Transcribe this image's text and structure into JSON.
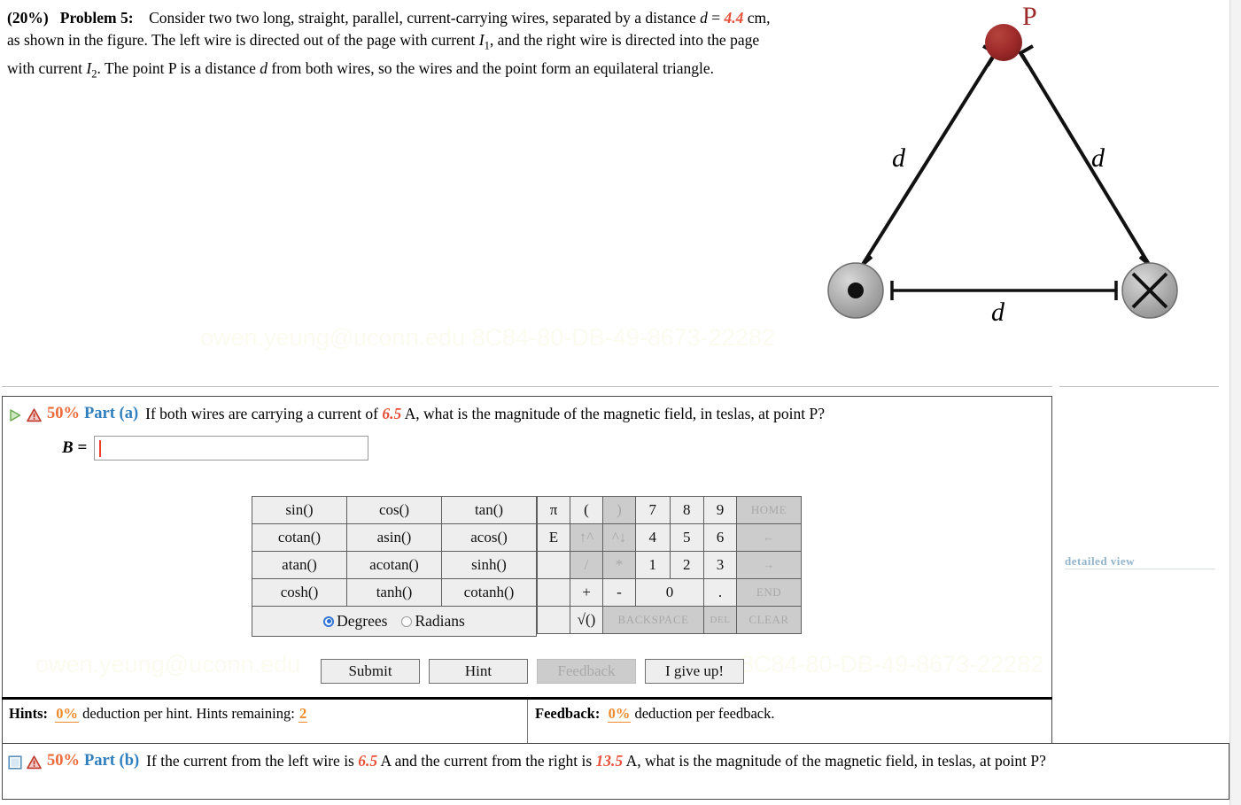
{
  "problem": {
    "weight": "(20%)",
    "label": "Problem 5:",
    "text_1": "Consider two two long, straight, parallel, current-carrying wires, separated by a distance ",
    "var_d": "d",
    "eq": " = ",
    "distance_value": "4.4",
    "text_2": " cm, as shown in the figure. The left wire is directed out of the page with current ",
    "current_1": "I",
    "current_1_sub": "1",
    "text_3": ", and the right wire is directed into the page with current ",
    "current_2": "I",
    "current_2_sub": "2",
    "text_4": ". The point P is a distance ",
    "var_d2": "d",
    "text_5": " from both wires, so the wires and the point form an equilateral triangle."
  },
  "figure": {
    "point_label": "P",
    "side_left_label": "d",
    "side_right_label": "d",
    "base_label": "d",
    "left_wire_symbol": "dot-out-of-page",
    "right_wire_symbol": "cross-into-page",
    "point_color": "#9e2a2a",
    "wire_fill": "#a9a9a9"
  },
  "part_a": {
    "percent": "50%",
    "name": "Part (a)",
    "text": "If both wires are carrying a current of ",
    "current_value": "6.5",
    "text_after": " A, what is the magnitude of the magnetic field, in teslas, at point P?",
    "answer_label": "B =",
    "answer_value": "",
    "expand_icon": "play-triangle-icon",
    "warning_icon": "warning-triangle-icon"
  },
  "part_b": {
    "percent": "50%",
    "name": "Part (b)",
    "text": "If the current from the left wire is ",
    "current_left": "6.5",
    "text_mid": " A and the current from the right is ",
    "current_right": "13.5",
    "text_after": " A, what is the magnitude of the magnetic field, in teslas, at point P?",
    "collapse_icon": "square-collapse-icon",
    "warning_icon": "warning-triangle-icon"
  },
  "calculator": {
    "trig_rows": [
      [
        "sin()",
        "cos()",
        "tan()"
      ],
      [
        "cotan()",
        "asin()",
        "acos()"
      ],
      [
        "atan()",
        "acotan()",
        "sinh()"
      ],
      [
        "cosh()",
        "tanh()",
        "cotanh()"
      ]
    ],
    "mode_degrees": "Degrees",
    "mode_radians": "Radians",
    "mode_selected": "Degrees",
    "keys": {
      "pi": "π",
      "paren_open": "(",
      "paren_close": ")",
      "exp": "E",
      "up_arrow": "↑^",
      "down_arrow": "^↓",
      "divide": "/",
      "multiply": "*",
      "plus": "+",
      "minus": "-",
      "zero": "0",
      "dot": ".",
      "sqrt": "√()",
      "seven": "7",
      "eight": "8",
      "nine": "9",
      "four": "4",
      "five": "5",
      "six": "6",
      "one": "1",
      "two": "2",
      "three": "3",
      "home": "HOME",
      "left": "←",
      "right": "→",
      "end": "END",
      "backspace": "BACKSPACE",
      "del": "DEL",
      "clear": "CLEAR"
    }
  },
  "actions": {
    "submit": "Submit",
    "hint": "Hint",
    "feedback": "Feedback",
    "give_up": "I give up!"
  },
  "status_bar": {
    "hints_label": "Hints:",
    "hints_deduction": "0%",
    "hints_text": " deduction per hint. Hints remaining: ",
    "hints_remaining": "2",
    "feedback_label": "Feedback:",
    "feedback_deduction": "0%",
    "feedback_text": " deduction per feedback."
  },
  "ghost_link": "detailed view",
  "watermark": {
    "email": "owen.yeung@uconn.edu",
    "code": "8C84-80-DB-49-8673-22282",
    "combined": "owen.yeung@uconn.edu 8C84-80-DB-49-8673-22282"
  }
}
